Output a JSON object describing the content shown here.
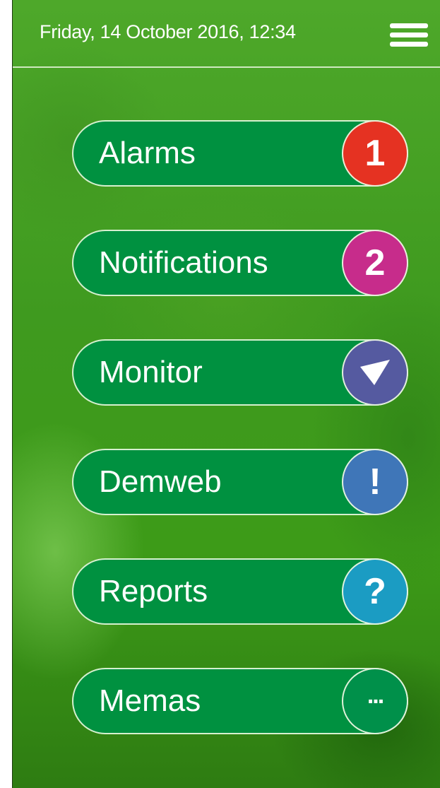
{
  "header": {
    "datetime": "Friday, 14 October 2016, 12:34",
    "menu_icon": "hamburger-menu-icon"
  },
  "menu": {
    "items": [
      {
        "label": "Alarms",
        "badge_text": "1",
        "badge_icon": "number-badge-icon",
        "badge_color": "#e53222"
      },
      {
        "label": "Notifications",
        "badge_text": "2",
        "badge_icon": "number-badge-icon",
        "badge_color": "#c72c8b"
      },
      {
        "label": "Monitor",
        "badge_text": "",
        "badge_icon": "send-arrow-icon",
        "badge_color": "#555aa0"
      },
      {
        "label": "Demweb",
        "badge_text": "!",
        "badge_icon": "exclamation-icon",
        "badge_color": "#3f76b8"
      },
      {
        "label": "Reports",
        "badge_text": "?",
        "badge_icon": "question-icon",
        "badge_color": "#1b9cc3"
      },
      {
        "label": "Memas",
        "badge_text": "...",
        "badge_icon": "more-dots-icon",
        "badge_color": "#00904a"
      }
    ]
  }
}
